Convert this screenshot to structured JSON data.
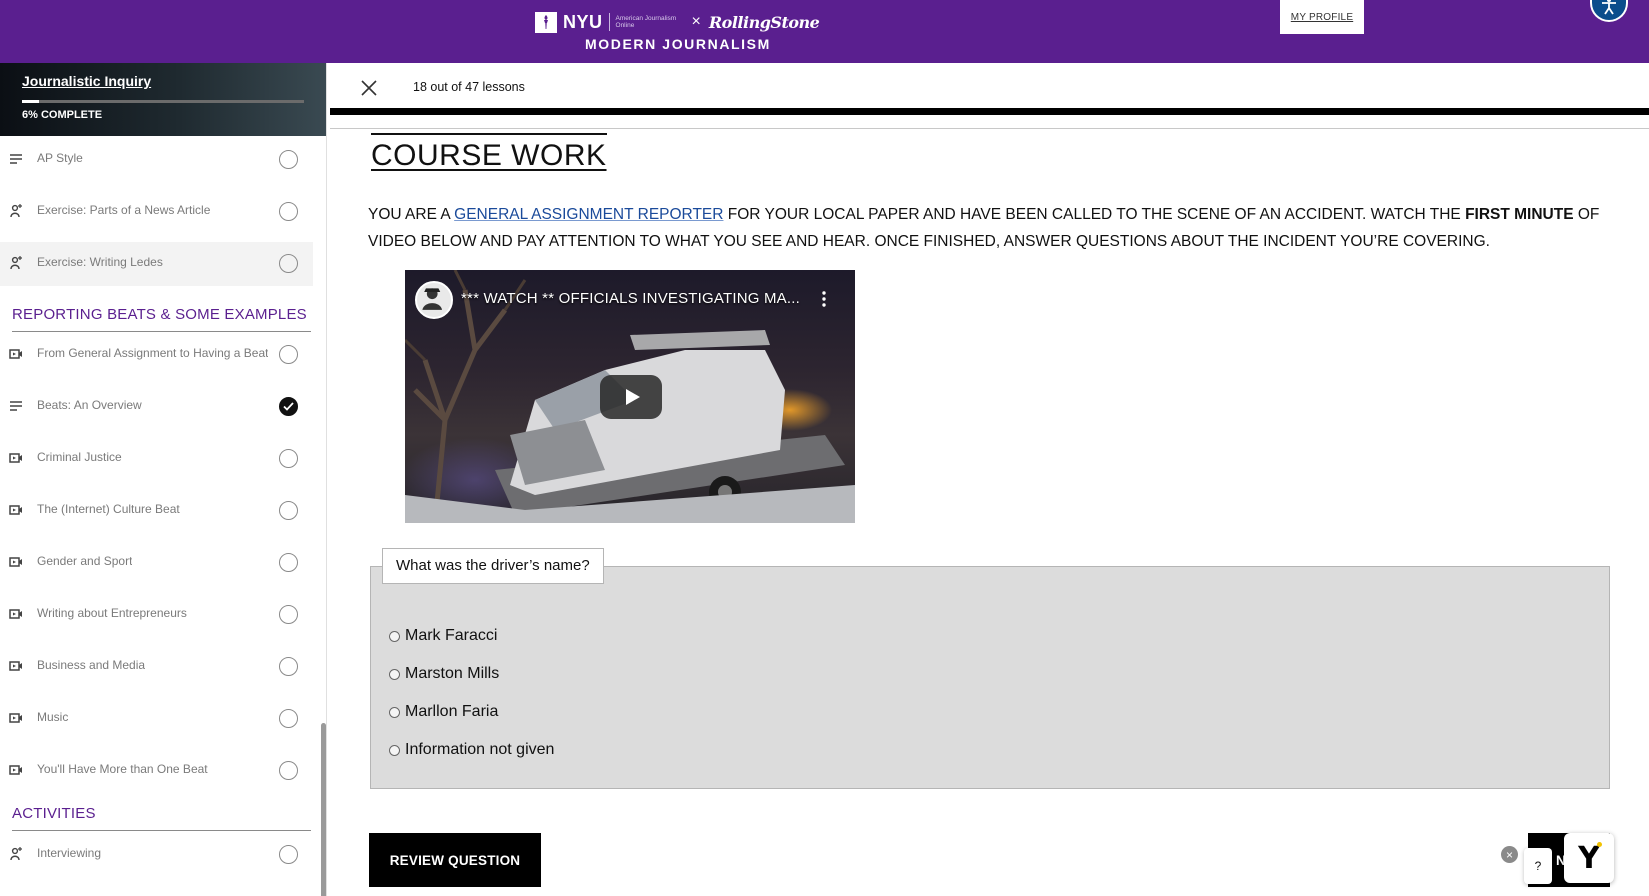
{
  "header": {
    "nyu": "NYU",
    "partner_small": "American Journalism Online",
    "times": "×",
    "rolling_stone": "RollingStone",
    "subtitle": "MODERN JOURNALISM",
    "profile_label": "MY PROFILE",
    "brand_color": "#5a1f8f"
  },
  "course": {
    "title": "Journalistic Inquiry",
    "progress_percent": 6,
    "progress_label": "6% COMPLETE"
  },
  "sidebar": {
    "lessons_top": [
      {
        "name": "AP Style",
        "type": "text-lesson-icon",
        "status": "incomplete"
      },
      {
        "name": "Exercise: Parts of a News Article",
        "type": "exercise-icon",
        "status": "incomplete"
      },
      {
        "name": "Exercise: Writing Ledes",
        "type": "exercise-icon",
        "status": "incomplete",
        "active": true
      }
    ],
    "section_beats": "REPORTING BEATS & SOME EXAMPLES",
    "lessons_beats": [
      {
        "name": "From General Assignment to Having a Beat",
        "type": "video-lesson-icon",
        "status": "incomplete"
      },
      {
        "name": "Beats: An Overview",
        "type": "text-lesson-icon",
        "status": "complete"
      },
      {
        "name": "Criminal Justice",
        "type": "video-lesson-icon",
        "status": "incomplete"
      },
      {
        "name": "The (Internet) Culture Beat",
        "type": "video-lesson-icon",
        "status": "incomplete"
      },
      {
        "name": "Gender and Sport",
        "type": "video-lesson-icon",
        "status": "incomplete"
      },
      {
        "name": "Writing about Entrepreneurs",
        "type": "video-lesson-icon",
        "status": "incomplete"
      },
      {
        "name": "Business and Media",
        "type": "video-lesson-icon",
        "status": "incomplete"
      },
      {
        "name": "Music",
        "type": "video-lesson-icon",
        "status": "incomplete"
      },
      {
        "name": "You'll Have More than One Beat",
        "type": "video-lesson-icon",
        "status": "incomplete"
      }
    ],
    "section_activities": "ACTIVITIES",
    "lessons_activities": [
      {
        "name": "Interviewing",
        "type": "exercise-icon",
        "status": "incomplete"
      }
    ]
  },
  "lesson_bar": {
    "count_text": "18 out of 47 lessons"
  },
  "content": {
    "title": "COURSE WORK",
    "intro_1": "YOU ARE A ",
    "intro_link": "GENERAL ASSIGNMENT REPORTER",
    "intro_2": " FOR YOUR LOCAL PAPER AND HAVE BEEN CALLED TO THE SCENE OF AN ACCIDENT. WATCH THE ",
    "intro_bold": "FIRST MINUTE",
    "intro_3": " OF VIDEO BELOW AND PAY ATTENTION TO WHAT YOU SEE AND HEAR. ONCE FINISHED, ANSWER QUESTIONS ABOUT THE INCIDENT YOU’RE COVERING.",
    "video_title": "*** WATCH ** OFFICIALS INVESTIGATING MA..."
  },
  "quiz": {
    "question": "What was the driver’s name?",
    "options": [
      "Mark Faracci",
      "Marston Mills",
      "Marllon Faria",
      "Information not given"
    ]
  },
  "actions": {
    "review_label": "REVIEW QUESTION",
    "next_label": "NEXT",
    "help_label": "?",
    "close_chat": "×",
    "widget_letter": "Y"
  }
}
